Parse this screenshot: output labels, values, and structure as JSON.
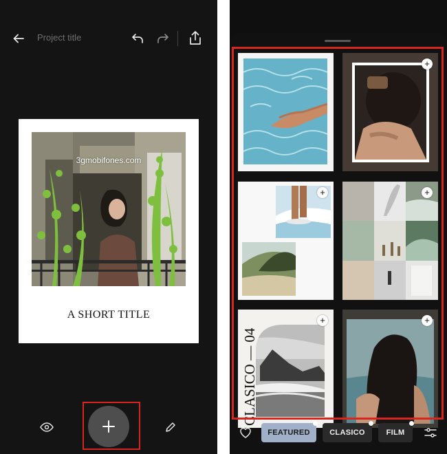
{
  "editor": {
    "title_placeholder": "Project title",
    "watermark": "3gmobifones.com",
    "card_title": "A SHORT TITLE"
  },
  "icons": [
    "arrow-left-icon",
    "undo-icon",
    "redo-icon",
    "share-icon",
    "eye-icon",
    "plus-icon",
    "pencil-icon",
    "heart-icon",
    "sliders-icon"
  ],
  "templates": {
    "vertical_text": "CLASICO — 04",
    "tabs": [
      {
        "label": "FEATURED",
        "active": true
      },
      {
        "label": "CLASICO",
        "active": false
      },
      {
        "label": "FILM",
        "active": false
      }
    ]
  },
  "colors": {
    "highlight": "#d7261e",
    "active_tab": "#9fb0c8",
    "background": "#141414"
  }
}
